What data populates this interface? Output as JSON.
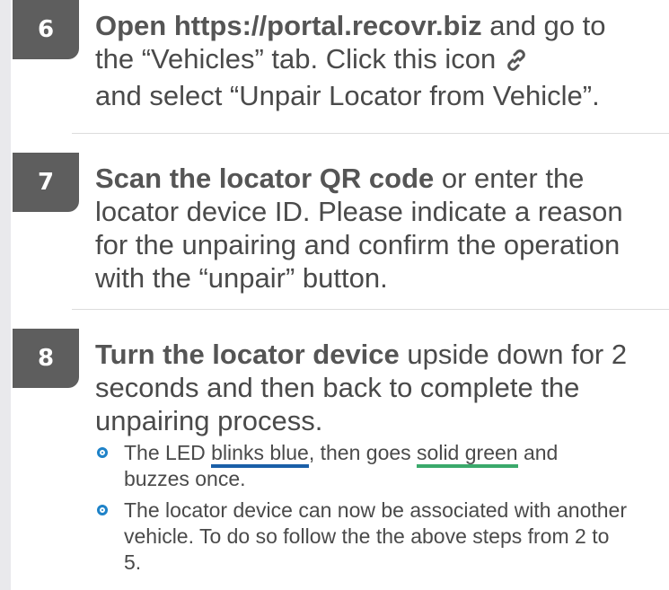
{
  "steps": [
    {
      "number": "6",
      "bold": "Open https://portal.recovr.biz",
      "text_a": " and go to the “Vehicles” tab. Click this icon",
      "text_b": "and select “Unpair Locator from Vehicle”.",
      "icon": "link-icon"
    },
    {
      "number": "7",
      "bold": "Scan the locator QR code",
      "text": " or enter the locator device ID. Please indicate a reason for the unpairing and confirm the operation with the “unpair” button."
    },
    {
      "number": "8",
      "bold": "Turn the locator device",
      "text": " upside down for 2 seconds and then back to complete the unpairing process.",
      "bullets": [
        {
          "pre": "The LED ",
          "highlight1": "blinks blue",
          "mid": ", then goes ",
          "highlight2": "solid green",
          "post": " and buzzes once."
        },
        {
          "text": "The locator device can now be associated with another vehicle. To do so follow the the above steps from 2 to 5."
        }
      ]
    }
  ],
  "colors": {
    "badge": "#5e5e5e",
    "bullet": "#1e82c8",
    "underline_blue": "#1a5fa8",
    "underline_green": "#3aa96b"
  }
}
